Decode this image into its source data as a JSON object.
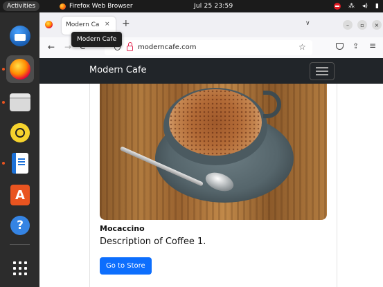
{
  "system": {
    "activities_label": "Activities",
    "app_name": "Firefox Web Browser",
    "clock": "Jul 25  23:59"
  },
  "dock": {
    "items": [
      {
        "name": "Thunderbird Mail"
      },
      {
        "name": "Firefox"
      },
      {
        "name": "Files"
      },
      {
        "name": "Rhythmbox"
      },
      {
        "name": "LibreOffice Writer"
      },
      {
        "name": "Ubuntu Software"
      },
      {
        "name": "Help"
      },
      {
        "name": "Show Applications"
      }
    ]
  },
  "browser": {
    "tab_title": "Modern Ca",
    "tab_close": "×",
    "new_tab": "+",
    "tab_list": "∨",
    "tooltip": "Modern Cafe",
    "url": "moderncafe.com",
    "back": "←",
    "forward": "→",
    "reload": "C",
    "bookmark": "☆",
    "extensions": "⇪",
    "menu": "≡",
    "window_min": "–",
    "window_max": "▫",
    "window_close": "×"
  },
  "site": {
    "brand": "Modern Cafe",
    "card": {
      "title": "Mocaccino",
      "description": "Description of Coffee 1.",
      "button_label": "Go to Store"
    }
  },
  "colors": {
    "navbar_bg": "#212529",
    "button_primary": "#0d6efd",
    "ubuntu_orange": "#e95420"
  }
}
